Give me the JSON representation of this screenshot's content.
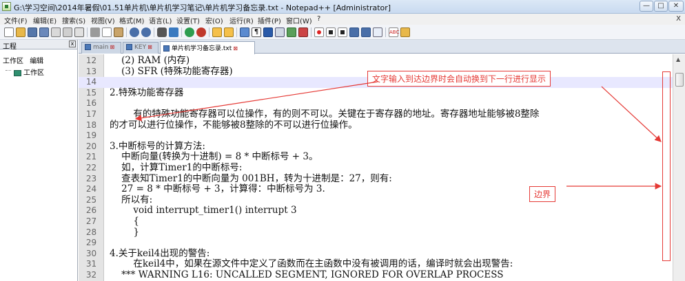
{
  "window": {
    "title": "G:\\学习空间\\2014年暑假\\01.51单片机\\单片机学习笔记\\单片机学习备忘录.txt - Notepad++ [Administrator]",
    "minimize": "—",
    "maximize": "□",
    "close": "✕"
  },
  "menu": {
    "items": [
      "文件(F)",
      "编辑(E)",
      "搜索(S)",
      "视图(V)",
      "格式(M)",
      "语言(L)",
      "设置(T)",
      "宏(O)",
      "运行(R)",
      "插件(P)",
      "窗口(W)",
      "?"
    ],
    "close_x": "X"
  },
  "toolbar": {
    "icons": [
      "new-file-icon",
      "open-file-icon",
      "save-icon",
      "save-all-icon",
      "close-icon",
      "close-all-icon",
      "print-icon",
      "cut-icon",
      "copy-icon",
      "paste-icon",
      "undo-icon",
      "redo-icon",
      "find-icon",
      "replace-icon",
      "zoom-in-icon",
      "zoom-out-icon",
      "sync-vertical-icon",
      "sync-horizontal-icon",
      "word-wrap-icon",
      "all-chars-icon",
      "indent-guide-icon",
      "doc-map-icon",
      "function-list-icon",
      "folder-workspace-icon",
      "record-macro-icon",
      "stop-record-icon",
      "play-macro-icon",
      "run-macro-multiple-icon",
      "save-macro-icon",
      "spellcheck-icon",
      "open-folder-icon"
    ]
  },
  "sidebar": {
    "title": "工程",
    "close": "x",
    "menu_workspace": "工作区",
    "menu_edit": "编辑",
    "tree_item": "工作区"
  },
  "tabs": [
    {
      "label": "main",
      "active": false
    },
    {
      "label": "KEY",
      "active": false
    },
    {
      "label": "单片机学习备忘录.txt",
      "active": true
    }
  ],
  "editor": {
    "lines": [
      {
        "n": "12",
        "text": "    (2) RAM (内存)"
      },
      {
        "n": "13",
        "text": "    (3) SFR (特殊功能寄存器)"
      },
      {
        "n": "14",
        "text": ""
      },
      {
        "n": "15",
        "text": "2.特殊功能寄存器"
      },
      {
        "n": "16",
        "text": ""
      },
      {
        "n": "17",
        "text": "        有的特殊功能寄存器可以位操作，有的则不可以。关键在于寄存器的地址。寄存器地址能够被8整除"
      },
      {
        "n": "18",
        "text": "的才可以进行位操作，不能够被8整除的不可以进行位操作。"
      },
      {
        "n": "19",
        "text": ""
      },
      {
        "n": "20",
        "text": "3.中断标号的计算方法:"
      },
      {
        "n": "21",
        "text": "    中断向量(转换为十进制) = 8 * 中断标号 + 3。"
      },
      {
        "n": "22",
        "text": "    如，计算Timer1的中断标号:"
      },
      {
        "n": "23",
        "text": "    查表知Timer1的中断向量为 001BH，转为十进制是：27，则有:"
      },
      {
        "n": "24",
        "text": "    27 = 8 * 中断标号 + 3，计算得：中断标号为 3."
      },
      {
        "n": "25",
        "text": "    所以有:"
      },
      {
        "n": "26",
        "text": "        void interrupt_timer1() interrupt 3"
      },
      {
        "n": "27",
        "text": "        {"
      },
      {
        "n": "28",
        "text": "        }"
      },
      {
        "n": "29",
        "text": ""
      },
      {
        "n": "30",
        "text": "4.关于keil4出现的警告:"
      },
      {
        "n": "31",
        "text": "        在keil4中，如果在源文件中定义了函数而在主函数中没有被调用的话，编译时就会出现警告:"
      },
      {
        "n": "32",
        "text": "    *** WARNING L16: UNCALLED SEGMENT, IGNORED FOR OVERLAP PROCESS"
      }
    ],
    "highlighted_line": "14"
  },
  "annotations": {
    "wrap_note": "文字输入到达边界时会自动换到下一行进行显示",
    "border_note": "边界",
    "color": "#e53935"
  }
}
